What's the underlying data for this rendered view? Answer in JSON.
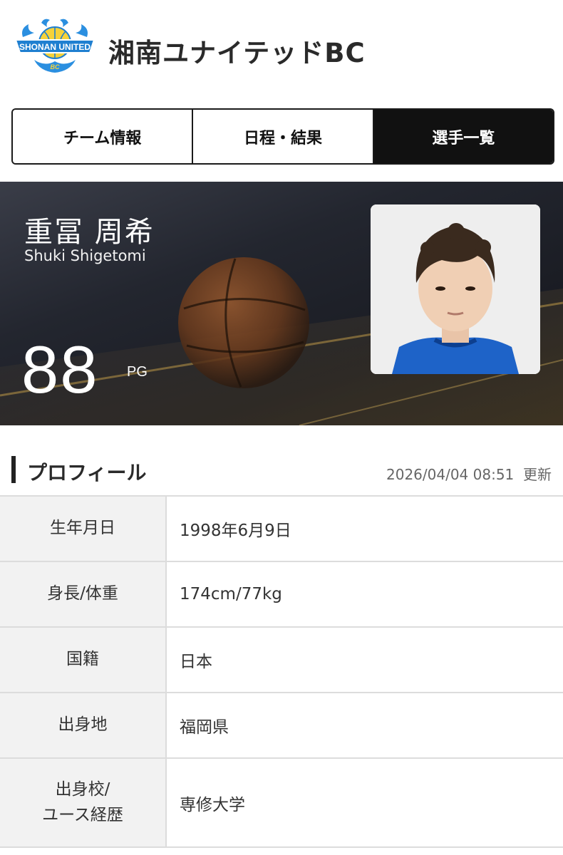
{
  "header": {
    "logo_text": "SHONAN UNITED",
    "logo_sub": "BC",
    "team_name": "湘南ユナイテッドBC"
  },
  "tabs": [
    {
      "label": "チーム情報",
      "active": false
    },
    {
      "label": "日程・結果",
      "active": false
    },
    {
      "label": "選手一覧",
      "active": true
    }
  ],
  "player": {
    "name_jp": "重冨 周希",
    "name_en": "Shuki Shigetomi",
    "number": "88",
    "position": "PG"
  },
  "profile": {
    "title": "プロフィール",
    "updated_date": "2026/04/04 08:51",
    "updated_label": "更新",
    "rows": [
      {
        "label": "生年月日",
        "value": "1998年6月9日"
      },
      {
        "label": "身長/体重",
        "value": "174cm/77kg"
      },
      {
        "label": "国籍",
        "value": "日本"
      },
      {
        "label": "出身地",
        "value": "福岡県"
      },
      {
        "label_line1": "出身校/",
        "label_line2": "ユース経歴",
        "value": "専修大学"
      }
    ]
  },
  "colors": {
    "accent": "#111111",
    "logo_blue": "#1f7fd0",
    "logo_yellow": "#f5d23a",
    "jersey_blue": "#1e63c8"
  }
}
